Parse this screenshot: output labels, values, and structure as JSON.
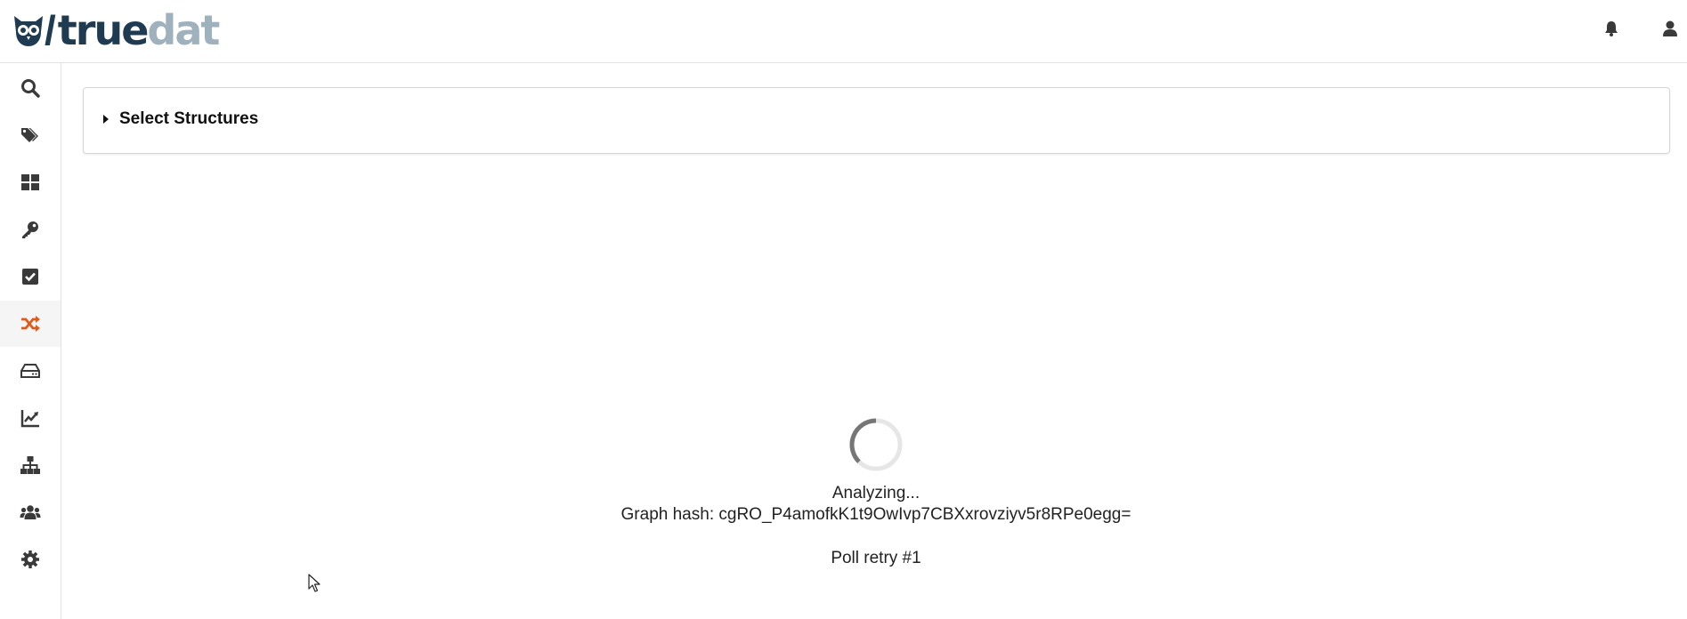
{
  "app": {
    "logo_prefix": "true",
    "logo_suffix": "dat"
  },
  "colors": {
    "accent": "#e05a1a",
    "icon": "#3a3a3a",
    "brand_dark": "#1f3b51",
    "brand_light": "#9fb1bd"
  },
  "header": {
    "icons": [
      "bell-icon",
      "user-icon"
    ]
  },
  "sidebar": {
    "items": [
      {
        "icon": "search-icon",
        "active": false
      },
      {
        "icon": "tags-icon",
        "active": false
      },
      {
        "icon": "dashboard-icon",
        "active": false
      },
      {
        "icon": "key-icon",
        "active": false
      },
      {
        "icon": "check-square-icon",
        "active": false
      },
      {
        "icon": "shuffle-icon",
        "active": true
      },
      {
        "icon": "hdd-icon",
        "active": false
      },
      {
        "icon": "chart-line-icon",
        "active": false
      },
      {
        "icon": "sitemap-icon",
        "active": false
      },
      {
        "icon": "users-icon",
        "active": false
      },
      {
        "icon": "gear-icon",
        "active": false
      }
    ]
  },
  "main": {
    "panel_title": "Select Structures",
    "status": {
      "analyzing": "Analyzing...",
      "graph_hash": "Graph hash: cgRO_P4amofkK1t9OwIvp7CBXxrovziyv5r8RPe0egg=",
      "poll_retry": "Poll retry #1"
    }
  }
}
